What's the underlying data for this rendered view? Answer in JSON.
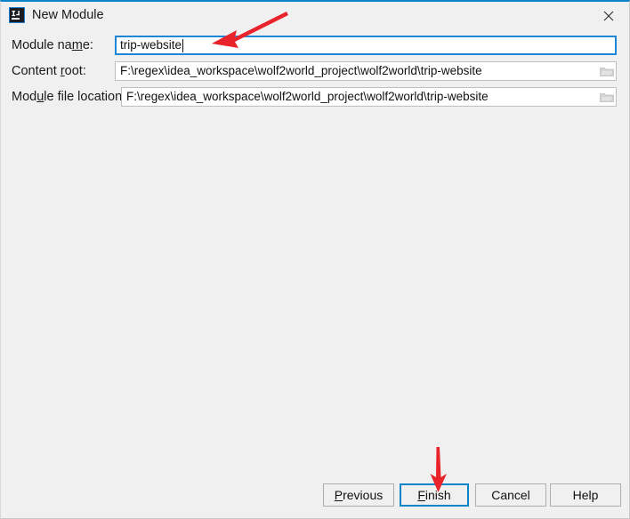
{
  "window": {
    "title": "New Module",
    "icon": "intellij-idea-icon",
    "close_icon": "close-icon",
    "accent_color": "#0a84c8",
    "background_color": "#f0f0f0"
  },
  "form": {
    "rows": [
      {
        "label_before": "Module na",
        "label_mnemonic": "m",
        "label_after": "e:",
        "value": "trip-website",
        "placeholder": "",
        "focused": true,
        "has_browse": false,
        "browse_icon": ""
      },
      {
        "label_before": "Content ",
        "label_mnemonic": "r",
        "label_after": "oot:",
        "value": "F:\\regex\\idea_workspace\\wolf2world_project\\wolf2world\\trip-website",
        "placeholder": "",
        "focused": false,
        "has_browse": true,
        "browse_icon": "folder-icon"
      },
      {
        "label_before": "Mod",
        "label_mnemonic": "u",
        "label_after": "le file location:",
        "value": "F:\\regex\\idea_workspace\\wolf2world_project\\wolf2world\\trip-website",
        "placeholder": "",
        "focused": false,
        "has_browse": true,
        "browse_icon": "folder-icon"
      }
    ]
  },
  "buttons": {
    "previous": {
      "before": "",
      "mnemonic": "P",
      "after": "revious"
    },
    "finish": {
      "before": "",
      "mnemonic": "F",
      "after": "inish",
      "focused": true
    },
    "cancel": {
      "before": "",
      "mnemonic": "C",
      "after": "ancel"
    },
    "help": {
      "before": "",
      "mnemonic": "H",
      "after": "elp"
    }
  },
  "annotations": {
    "color": "#e8232a",
    "arrow_to_module_name": "red-arrow-pointing-to-module-name-field",
    "arrow_to_finish": "red-arrow-pointing-to-finish-button"
  }
}
